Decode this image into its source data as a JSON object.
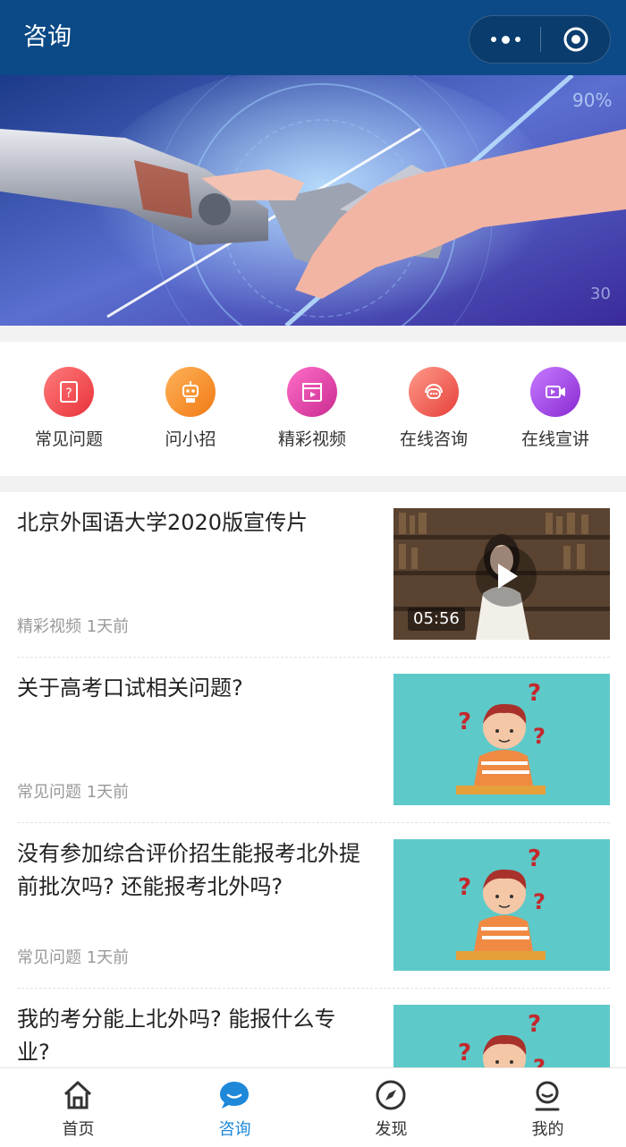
{
  "header": {
    "title": "咨询"
  },
  "nav": [
    {
      "label": "常见问题",
      "icon": "question-doc-icon",
      "color": "#f0494e"
    },
    {
      "label": "问小招",
      "icon": "robot-icon",
      "color": "#f08a1e"
    },
    {
      "label": "精彩视频",
      "icon": "clapperboard-icon",
      "color": "#e23fa4"
    },
    {
      "label": "在线咨询",
      "icon": "chat-headset-icon",
      "color": "#ef5a55"
    },
    {
      "label": "在线宣讲",
      "icon": "video-camera-icon",
      "color": "#9a3ad8"
    }
  ],
  "list": [
    {
      "title": "北京外国语大学2020版宣传片",
      "meta": "精彩视频 1天前",
      "thumb": "video",
      "duration": "05:56"
    },
    {
      "title": "关于高考口试相关问题?",
      "meta": "常见问题 1天前",
      "thumb": "question-boy"
    },
    {
      "title": "没有参加综合评价招生能报考北外提前批次吗? 还能报考北外吗?",
      "meta": "常见问题 1天前",
      "thumb": "question-boy"
    },
    {
      "title": "我的考分能上北外吗? 能报什么专业?",
      "meta": "",
      "thumb": "question-boy"
    }
  ],
  "tabbar": [
    {
      "label": "首页",
      "icon": "home-icon",
      "active": false
    },
    {
      "label": "咨询",
      "icon": "chat-bubble-icon",
      "active": true
    },
    {
      "label": "发现",
      "icon": "compass-icon",
      "active": false
    },
    {
      "label": "我的",
      "icon": "user-icon",
      "active": false
    }
  ],
  "colors": {
    "header": "#0b4a86",
    "active_tab": "#1e88d9",
    "teal_thumb": "#5ec9c9"
  }
}
